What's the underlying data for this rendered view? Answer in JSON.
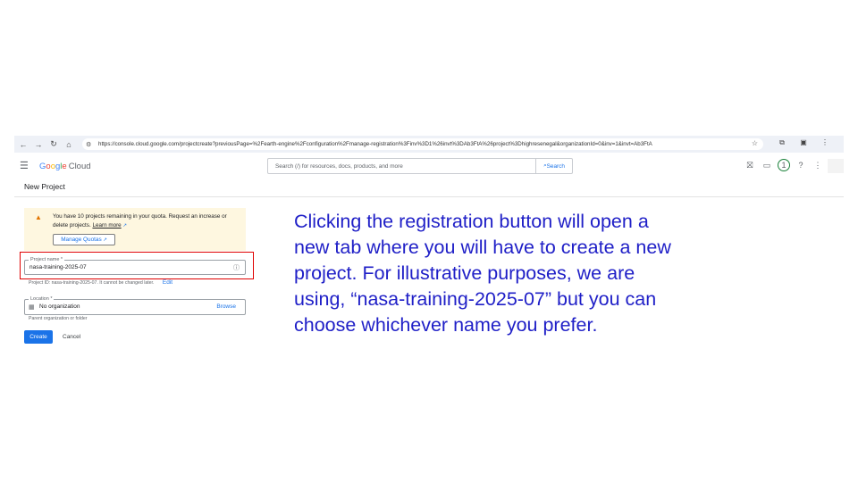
{
  "browser": {
    "url": "https://console.cloud.google.com/projectcreate?previousPage=%2Fearth-engine%2Fconfiguration%2Fmanage-registration%3Finv%3D1%26invt%3DAb3FtA%26project%3Dhighresenegal&organizationId=0&inv=1&invt=Ab3FtA"
  },
  "header": {
    "logo_g": "G",
    "logo_o1": "o",
    "logo_o2": "o",
    "logo_g2": "g",
    "logo_l": "l",
    "logo_e": "e",
    "logo_cloud": "Cloud",
    "search_placeholder": "Search (/) for resources, docs, products, and more",
    "search_button": "Search",
    "notification_count": "1"
  },
  "page": {
    "title": "New Project",
    "notice": {
      "text": "You have 10 projects remaining in your quota. Request an increase or delete projects.",
      "learn_more": "Learn more",
      "button": "Manage Quotas"
    },
    "project_name": {
      "label": "Project name *",
      "value": "nasa-training-2025-07",
      "project_id_text": "Project ID: nasa-training-2025-07. It cannot be changed later.",
      "edit_label": "Edit"
    },
    "location": {
      "label": "Location *",
      "value": "No organization",
      "browse": "Browse",
      "hint": "Parent organization or folder"
    },
    "create": "Create",
    "cancel": "Cancel"
  },
  "caption": {
    "lines": [
      "Clicking the registration button will open a",
      "new tab where you will have to create a new",
      "project. For illustrative purposes, we are",
      "using, “nasa-training-2025-07” but you can",
      "choose whichever name you prefer."
    ]
  },
  "colors": {
    "accent": "#1a73e8",
    "highlight": "#e00000",
    "caption": "#1f1fc7",
    "notice_bg": "#fef7e0"
  }
}
